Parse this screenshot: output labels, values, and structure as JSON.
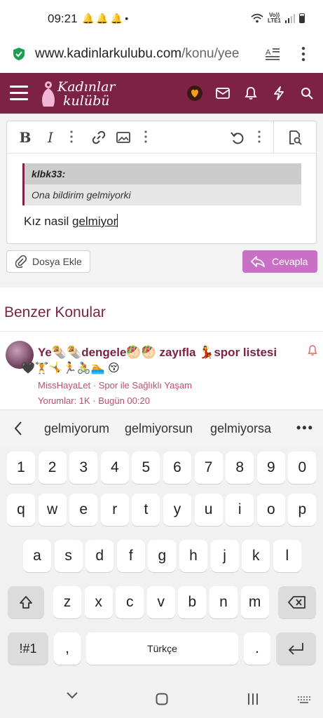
{
  "status": {
    "time": "09:21",
    "network_label_top": "Vo))",
    "network_label_bottom": "LTE1"
  },
  "browser": {
    "url_domain": "www.kadinlarkulubu.com",
    "url_path": "/konu/yee"
  },
  "site": {
    "logo_line1": "Kadınlar",
    "logo_line2": "kulübü",
    "brand_color": "#7d2245"
  },
  "editor": {
    "quote_author": "klbk33:",
    "quote_text": "Ona bildirim gelmiyorki",
    "text_before": "Kız nasil ",
    "text_underlined": "gelmiyor",
    "attach_label": "Dosya Ekle",
    "reply_label": "Cevapla"
  },
  "similar": {
    "title": "Benzer Konular",
    "thread": {
      "title": "Ye🌯🌯dengele🥙🥙 zayıfla 💃spor listesi",
      "title_line2": "🖤🏋️🤸🏃🚴🏊 😚",
      "author": "MissHayaLet",
      "separator": " · ",
      "forum": "Spor ile Sağlıklı Yaşam",
      "stats": "Yorumlar: 1K · Bugün 00:20"
    }
  },
  "suggestions": [
    "gelmiyorum",
    "gelmiyorsun",
    "gelmiyorsa"
  ],
  "keyboard": {
    "row1": [
      "1",
      "2",
      "3",
      "4",
      "5",
      "6",
      "7",
      "8",
      "9",
      "0"
    ],
    "row2": [
      "q",
      "w",
      "e",
      "r",
      "t",
      "y",
      "u",
      "i",
      "o",
      "p"
    ],
    "row3": [
      "a",
      "s",
      "d",
      "f",
      "g",
      "h",
      "j",
      "k",
      "l"
    ],
    "row4": [
      "z",
      "x",
      "c",
      "v",
      "b",
      "n",
      "m"
    ],
    "symbols_key": "!#1",
    "comma_key": ",",
    "space_label": "Türkçe",
    "period_key": "."
  },
  "icons": {
    "secure": "shield-check-icon",
    "reader": "reader-mode-icon",
    "menu": "kebab-icon"
  }
}
